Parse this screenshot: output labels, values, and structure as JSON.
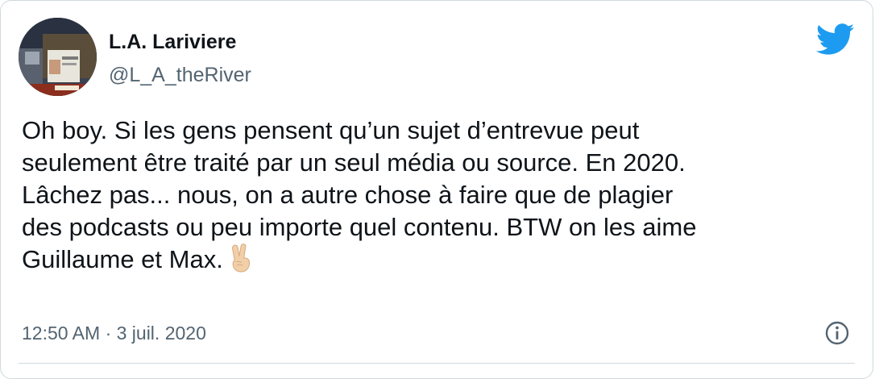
{
  "tweet": {
    "author": {
      "display_name": "L.A. Lariviere",
      "handle": "@L_A_theRiver"
    },
    "text": "Oh boy. Si les gens pensent qu’un sujet d’entrevue peut\nseulement être traité par un seul média ou source. En 2020.\nLâchez pas... nous, on a autre chose à faire que de plagier\ndes podcasts ou peu importe quel contenu. BTW on les aime\nGuillaume et Max.",
    "trailing_emoji": "victory-hand",
    "timestamp": "12:50 AM · 3 juil. 2020"
  },
  "icons": {
    "brand": "twitter-bird-icon",
    "info": "info-icon"
  },
  "colors": {
    "brand_blue": "#1d9bf0",
    "text_primary": "#0f1419",
    "text_secondary": "#536471",
    "border": "#cfd9de"
  }
}
